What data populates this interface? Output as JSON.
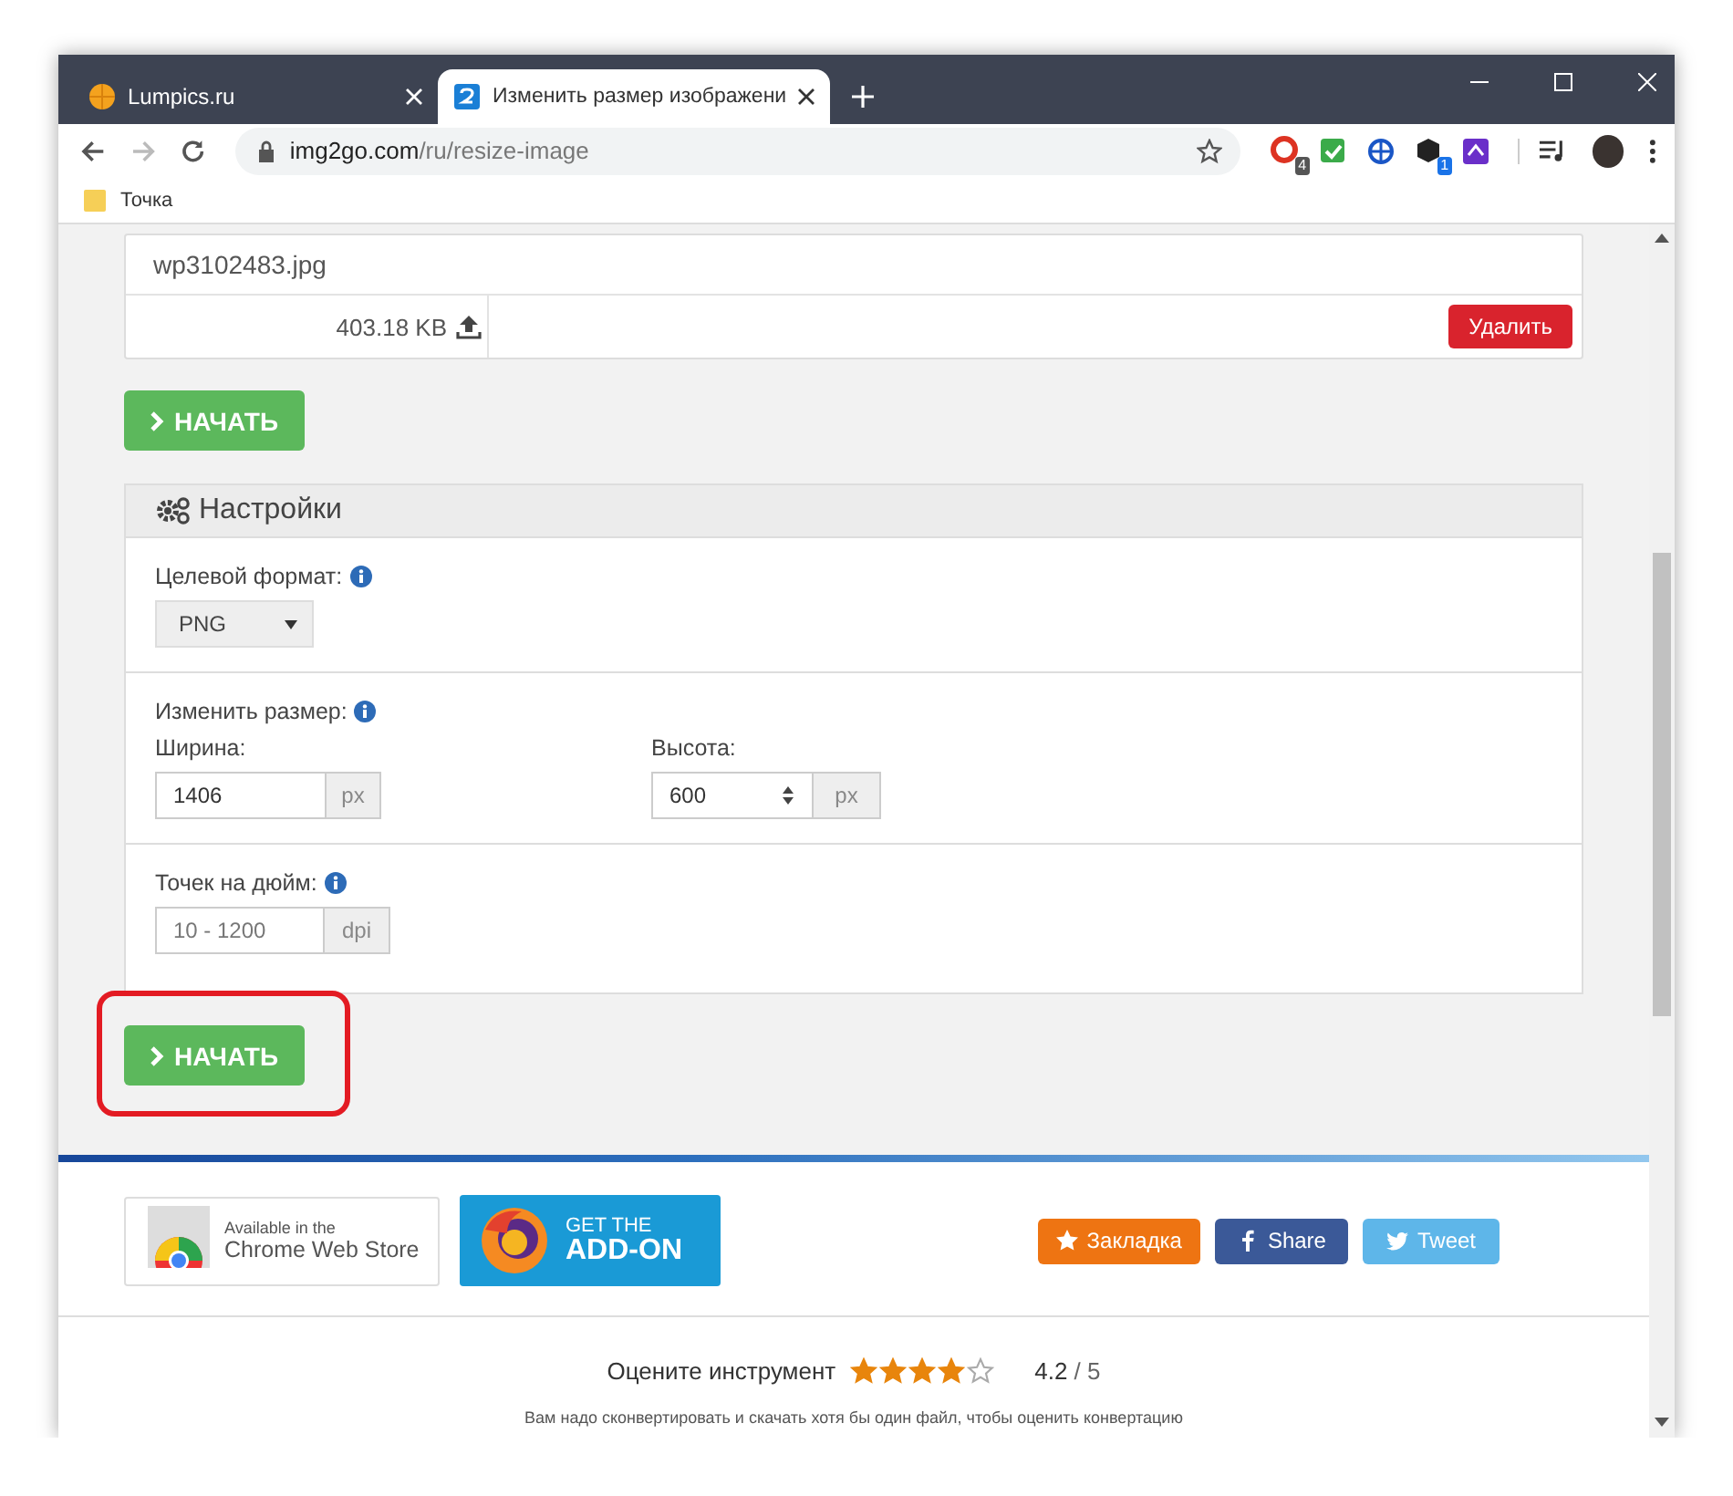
{
  "browser": {
    "tabs": [
      {
        "title": "Lumpics.ru",
        "kind": "lumpics",
        "selected": false
      },
      {
        "title": "Изменить размер изображени",
        "kind": "img2go",
        "selected": true
      }
    ],
    "url_host": "img2go.com",
    "url_path": "/ru/resize-image",
    "extensions": [
      {
        "kind": "red",
        "badge": "4"
      },
      {
        "kind": "check"
      },
      {
        "kind": "globe"
      },
      {
        "kind": "box",
        "badge": "1"
      },
      {
        "kind": "purple"
      }
    ],
    "bookmarks": [
      {
        "title": "Точка"
      }
    ]
  },
  "file": {
    "name": "wp3102483.jpg",
    "size": "403.18 KB",
    "delete_label": "Удалить"
  },
  "start_buttons": [
    {
      "label": "НАЧАТЬ",
      "highlighted": false
    }
  ],
  "settings": {
    "title": "Настройки",
    "format": {
      "label": "Целевой формат:",
      "value": "PNG"
    },
    "resize": {
      "label": "Изменить размер:",
      "width": {
        "label": "Ширина:",
        "value": "1406",
        "unit": "px"
      },
      "height": {
        "label": "Высота:",
        "value": "600",
        "unit": "px"
      }
    },
    "dpi": {
      "label": "Точек на дюйм:",
      "placeholder": "10 - 1200",
      "unit": "dpi"
    }
  },
  "start_buttons_after": [
    {
      "label": "НАЧАТЬ",
      "highlighted": true
    }
  ],
  "footer": {
    "chrome_badge": {
      "line1": "Available in the",
      "line2": "Chrome Web Store"
    },
    "firefox_badge": {
      "line1": "GET THE",
      "line2": "ADD-ON"
    },
    "share_buttons": [
      {
        "kind": "bookmark",
        "label": "Закладка"
      },
      {
        "kind": "facebook",
        "label": "Share"
      },
      {
        "kind": "twitter",
        "label": "Tweet"
      }
    ],
    "rating": {
      "label": "Оцените инструмент",
      "stars": 4,
      "score": "4.2",
      "out_of": "/ 5"
    },
    "note": "Вам надо сконвертировать и скачать хотя бы один файл, чтобы оценить конвертацию"
  }
}
